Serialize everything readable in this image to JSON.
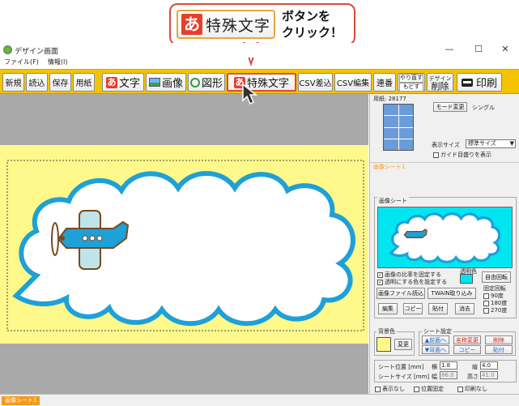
{
  "callout": {
    "button_label": "特殊文字",
    "icon_glyph": "あ",
    "instruction_line1": "ボタンを",
    "instruction_line2": "クリック！"
  },
  "window": {
    "title": "デザイン画面",
    "minimize": "—",
    "maximize": "☐",
    "close": "✕"
  },
  "menu": {
    "file": "ファイル(F)",
    "info": "情報(I)"
  },
  "toolbar": {
    "new": "新規",
    "load": "読込",
    "save": "保存",
    "paper": "用紙",
    "text_icon": "あ",
    "text": "文字",
    "image": "画像",
    "shape": "図形",
    "special_icon": "あ",
    "special": "特殊文字",
    "csv_import": "CSV差込",
    "csv_edit": "CSV編集",
    "serial": "連番",
    "undo": "やり直す",
    "redo": "もどす",
    "design_top": "デザイン",
    "delete": "削除",
    "print": "印刷"
  },
  "panel": {
    "paper_label": "用紙: 28177",
    "mode_change": "モード変更",
    "single": "シングル",
    "display_size_label": "表示サイズ",
    "display_size_value": "標準サイズ",
    "guide_show": "ガイド目盛りを表示",
    "image_sheet_header": "画像シート1",
    "image_sheet_group": "画像シート",
    "fix_ratio": "画像の比率を固定する",
    "set_transparent": "透明にする色を設定する",
    "transparent_color": "透明色",
    "free_rotate": "自由回転",
    "fixed_rotate": "固定回転",
    "rot90": "90度",
    "rot180": "180度",
    "rot270": "270度",
    "load_file": "画像ファイル読込",
    "twain": "TWAIN取り込み",
    "edit": "編集",
    "copy": "コピー",
    "paste": "貼付",
    "erase": "消去",
    "bg_color": "背景色",
    "change": "変更",
    "sheet_setting": "シート設定",
    "front": "▲前面へ",
    "back": "▼背面へ",
    "rename": "名称変更",
    "sheet_copy": "コピー",
    "sheet_delete": "削除",
    "sheet_paste": "貼付",
    "sheet_pos_label": "シート位置 [mm]",
    "horiz": "横",
    "horiz_val": "1.8",
    "vert": "縦",
    "vert_val": "4.0",
    "sheet_size_label": "シートサイズ [mm]",
    "width": "幅",
    "width_val": "86.0",
    "height": "高さ",
    "height_val": "41.0",
    "hide": "表示なし",
    "pos_fixed": "位置固定",
    "no_print": "印刷なし"
  },
  "status": {
    "tab": "画像シート1"
  },
  "colors": {
    "toolbar": "#f5c400",
    "sheet_bg": "#fff88a",
    "cloud_border": "#1ea0d8",
    "accent_red": "#d94a3c",
    "preview_cyan": "#00e5f0"
  }
}
